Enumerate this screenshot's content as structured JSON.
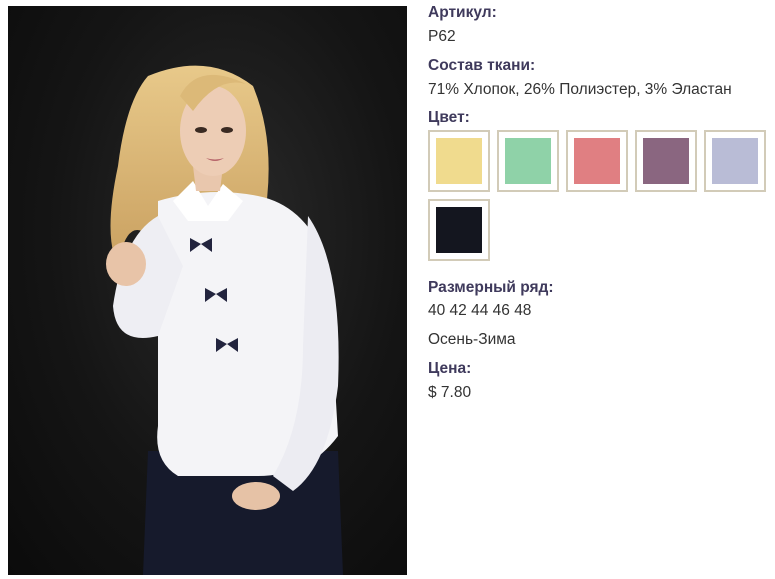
{
  "product": {
    "image_alt": "Белая блузка с бантами",
    "article_label": "Артикул:",
    "article_value": "P62",
    "fabric_label": "Состав ткани:",
    "fabric_value": "71% Хлопок, 26% Полиэстер, 3% Эластан",
    "color_label": "Цвет:",
    "swatches": [
      {
        "name": "yellow-swatch",
        "color": "#f0db8e"
      },
      {
        "name": "mint-swatch",
        "color": "#8fd2a8"
      },
      {
        "name": "pink-swatch",
        "color": "#e07f82"
      },
      {
        "name": "plum-swatch",
        "color": "#8a6680"
      },
      {
        "name": "lavender-swatch",
        "color": "#b9bcd6"
      },
      {
        "name": "black-swatch",
        "color": "#14161f"
      }
    ],
    "size_label": "Размерный ряд:",
    "size_value": "40 42 44 46 48",
    "season_value": "Осень-Зима",
    "price_label": "Цена:",
    "price_value": "$ 7.80"
  },
  "colors": {
    "label_color": "#3f3a5c",
    "swatch_border": "#d2cbb8"
  }
}
